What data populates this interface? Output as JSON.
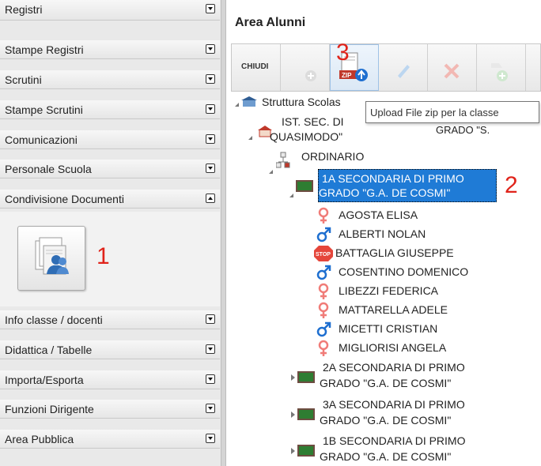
{
  "sidebar": {
    "items_top": [
      {
        "label": "Registri",
        "state": "collapsed"
      },
      {
        "label": "Stampe Registri",
        "state": "collapsed"
      },
      {
        "label": "Scrutini",
        "state": "collapsed"
      },
      {
        "label": "Stampe Scrutini",
        "state": "collapsed"
      },
      {
        "label": "Comunicazioni",
        "state": "collapsed"
      },
      {
        "label": "Personale Scuola",
        "state": "collapsed"
      },
      {
        "label": "Condivisione Documenti",
        "state": "expanded"
      }
    ],
    "panel_button_icon": "shared-documents-icon",
    "items_bottom": [
      {
        "label": "Info classe / docenti",
        "state": "collapsed"
      },
      {
        "label": "Didattica / Tabelle",
        "state": "collapsed"
      },
      {
        "label": "Importa/Esporta",
        "state": "collapsed"
      },
      {
        "label": "Funzioni Dirigente",
        "state": "collapsed"
      },
      {
        "label": "Area Pubblica",
        "state": "collapsed"
      }
    ]
  },
  "annotations": {
    "one": "1",
    "two": "2",
    "three": "3"
  },
  "main": {
    "title": "Area Alunni",
    "toolbar": {
      "close_label": "CHIUDI",
      "buttons": [
        {
          "icon": "add-icon",
          "enabled": false
        },
        {
          "icon": "upload-zip-icon",
          "enabled": true,
          "zip_text": "ZIP"
        },
        {
          "icon": "edit-icon",
          "enabled": false
        },
        {
          "icon": "delete-icon",
          "enabled": false
        },
        {
          "icon": "add-item-icon",
          "enabled": false
        }
      ]
    },
    "tooltip": "Upload File zip per la classe",
    "tree": {
      "root": "Struttura Scolas",
      "school_line1": "IST. SEC. DI",
      "school_line1_tail": "GRADO  \"S.",
      "school_line2": "QUASIMODO\"",
      "course": "ORDINARIO",
      "selected_class": {
        "line1": "1A SECONDARIA DI PRIMO",
        "line2": "GRADO \"G.A. DE COSMI\""
      },
      "students": [
        {
          "name": "AGOSTA ELISA",
          "gender": "female"
        },
        {
          "name": "ALBERTI NOLAN",
          "gender": "male"
        },
        {
          "name": "BATTAGLIA GIUSEPPE",
          "gender": "stop"
        },
        {
          "name": "COSENTINO DOMENICO",
          "gender": "male"
        },
        {
          "name": "LIBEZZI FEDERICA",
          "gender": "female"
        },
        {
          "name": "MATTARELLA ADELE",
          "gender": "female"
        },
        {
          "name": "MICETTI CRISTIAN",
          "gender": "male"
        },
        {
          "name": "MIGLIORISI ANGELA",
          "gender": "female"
        }
      ],
      "stop_text": "STOP",
      "other_classes": [
        {
          "line1": "2A SECONDARIA DI PRIMO",
          "line2": "GRADO \"G.A. DE COSMI\""
        },
        {
          "line1": "3A SECONDARIA DI PRIMO",
          "line2": "GRADO \"G.A. DE COSMI\""
        },
        {
          "line1": "1B SECONDARIA DI PRIMO",
          "line2": "GRADO \"G.A. DE COSMI\""
        }
      ]
    }
  },
  "colors": {
    "selection": "#1f7bd6",
    "female": "#f07c78",
    "male": "#1e6fd0",
    "stop": "#e5463b",
    "annotation": "#e0231a"
  }
}
